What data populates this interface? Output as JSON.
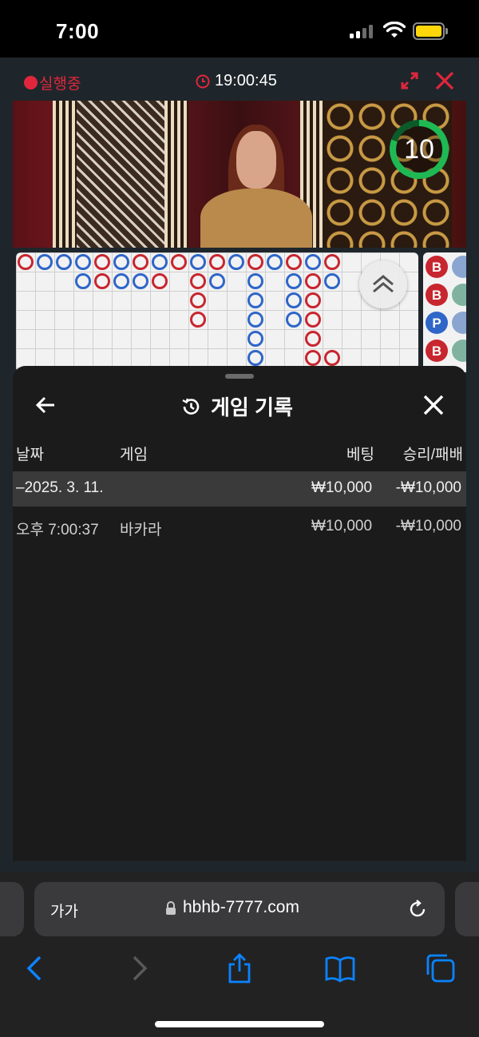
{
  "status_bar": {
    "time": "7:00",
    "battery_color": "#ffd60a"
  },
  "game_header": {
    "live_label": "실행중",
    "clock": "19:00:45",
    "accent_color": "#e0263c"
  },
  "video": {
    "countdown": "10"
  },
  "roadmap": {
    "red": "#c8262f",
    "blue": "#2f66c8",
    "side_labels": [
      "B",
      "B",
      "P",
      "B"
    ]
  },
  "history_sheet": {
    "title": "게임 기록",
    "columns": {
      "date": "날짜",
      "game": "게임",
      "bet": "베팅",
      "result": "승리/패배"
    },
    "groups": [
      {
        "date": "–2025. 3. 11.",
        "bet_total": "₩10,000",
        "result_total": "-₩10,000",
        "rows": [
          {
            "time": "오후 7:00:37",
            "game": "바카라",
            "bet": "₩10,000",
            "result": "-₩10,000"
          }
        ]
      }
    ]
  },
  "browser": {
    "text_size_label": "가가",
    "url": "hbhb-7777.com",
    "accent_color": "#0a84ff"
  }
}
